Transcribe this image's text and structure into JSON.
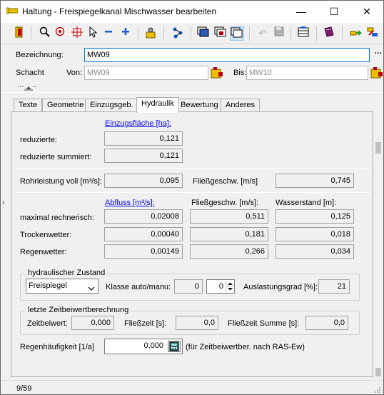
{
  "window": {
    "title": "Haltung - Freispiegelkanal Mischwasser bearbeiten",
    "minimize": "—",
    "maximize": "☐",
    "close": "✕"
  },
  "toolbar": {
    "icons": [
      "exit-icon",
      "search-icon",
      "zoom-icon",
      "crosshair-icon",
      "pointer-icon",
      "minus-icon",
      "plus-icon",
      "tools-icon",
      "network-icon",
      "window-icon",
      "window-edit-icon",
      "window-copy-icon",
      "undo-icon",
      "save-icon",
      "grid-icon",
      "book-icon",
      "move-icon",
      "swap-icon"
    ]
  },
  "header": {
    "bezeichnung_label": "Bezeichnung:",
    "bezeichnung_value": "MW09",
    "schacht_label": "Schacht",
    "von_label": "Von:",
    "von_value": "MW09",
    "bis_label": "Bis:",
    "bis_value": "MW10",
    "more_button": "···"
  },
  "tabs": [
    "Texte",
    "Geometrie",
    "Einzugsgeb.",
    "Hydraulik",
    "Bewertung",
    "Anderes"
  ],
  "active_tab": "Hydraulik",
  "hydraulik": {
    "einzugsflaeche_link": "Einzugsfläche [ha]:",
    "reduzierte_label": "reduzierte:",
    "reduzierte_value": "0,121",
    "reduzierte_summiert_label": "reduzierte summiert:",
    "reduzierte_summiert_value": "0,121",
    "rohrleistung_label": "Rohrleistung voll [m³/s]:",
    "rohrleistung_value": "0,095",
    "fliessgeschw_label": "Fließgeschw. [m/s]",
    "fliessgeschw_value": "0,745",
    "abfluss_link": "Abfluss [m³/s]:",
    "col_fliessgeschw": "Fließgeschw. [m/s]:",
    "col_wasserstand": "Wasserstand [m]:",
    "rows": [
      {
        "label": "maximal rechnerisch:",
        "abfluss": "0,02008",
        "geschw": "0,511",
        "wasserstand": "0,125"
      },
      {
        "label": "Trockenwetter:",
        "abfluss": "0,00040",
        "geschw": "0,181",
        "wasserstand": "0,018"
      },
      {
        "label": "Regenwetter:",
        "abfluss": "0,00149",
        "geschw": "0,266",
        "wasserstand": "0,034"
      }
    ],
    "zustand_group": "hydraulischer Zustand",
    "zustand_value": "Freispiegel",
    "klasse_label": "Klasse auto/manu:",
    "klasse_auto": "0",
    "klasse_manu": "0",
    "auslastung_label": "Auslastungsgrad [%]:",
    "auslastung_value": "21",
    "zeitbeiwert_group": "letzte Zeitbeiwertberechnung",
    "zeitbeiwert_label": "Zeitbeiwert:",
    "zeitbeiwert_value": "0,000",
    "fliesszeit_label": "Fließzeit [s]:",
    "fliesszeit_value": "0,0",
    "fliesszeit_summe_label": "Fließzeit Summe [s]:",
    "fliesszeit_summe_value": "0,0",
    "regenhaeufigkeit_label": "Regenhäufigkeit [1/a]",
    "regenhaeufigkeit_value": "0,000",
    "regenhaeufigkeit_note": "(für Zeitbeiwertber. nach RAS-Ew)"
  },
  "status": {
    "record": "9/59"
  },
  "colors": {
    "link": "#0000ee",
    "focus_border": "#0078d7",
    "toolbar_selected": "#cce4f7"
  }
}
